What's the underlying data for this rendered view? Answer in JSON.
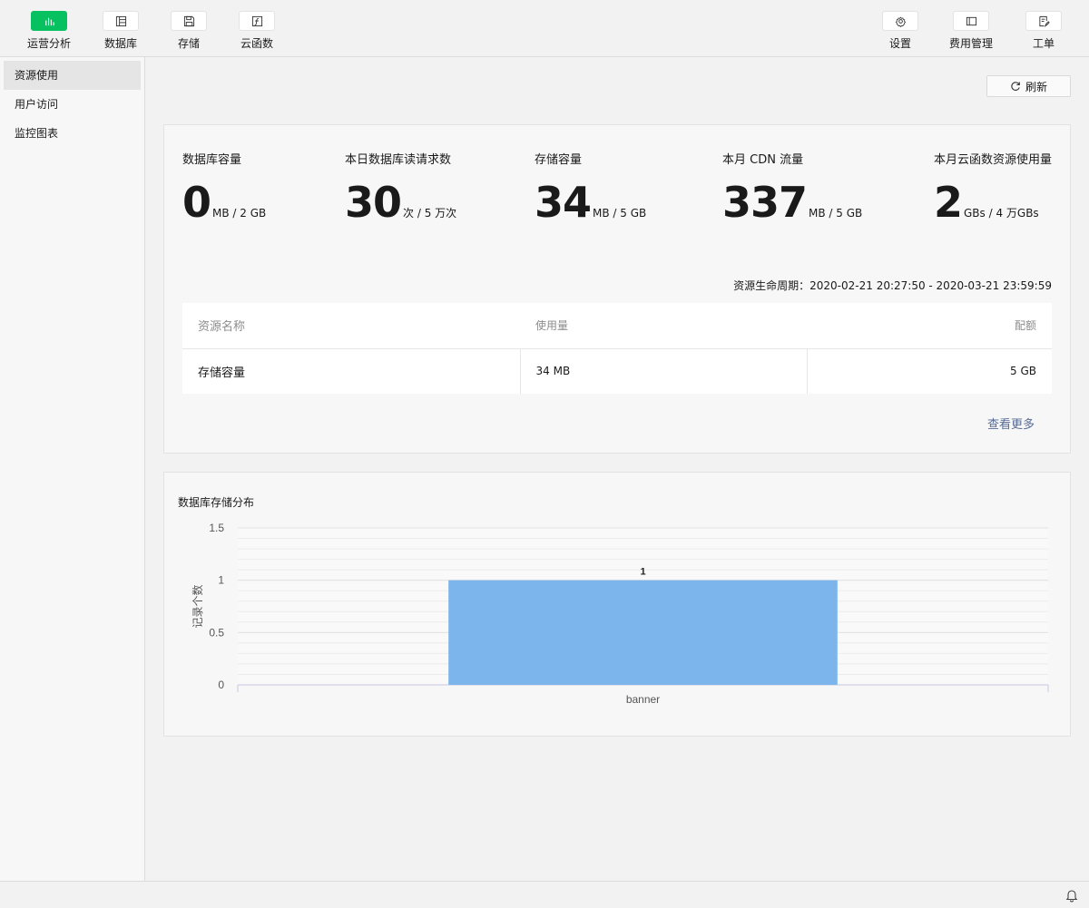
{
  "nav": {
    "left": [
      {
        "label": "运营分析",
        "icon": "bar-chart-icon"
      },
      {
        "label": "数据库",
        "icon": "database-icon"
      },
      {
        "label": "存储",
        "icon": "save-icon"
      },
      {
        "label": "云函数",
        "icon": "function-icon"
      }
    ],
    "right": [
      {
        "label": "设置",
        "icon": "gear-icon"
      },
      {
        "label": "费用管理",
        "icon": "billing-icon"
      },
      {
        "label": "工单",
        "icon": "ticket-icon"
      }
    ]
  },
  "sidebar": {
    "items": [
      {
        "label": "资源使用"
      },
      {
        "label": "用户访问"
      },
      {
        "label": "监控图表"
      }
    ]
  },
  "toolbar": {
    "refresh_label": "刷新"
  },
  "stats": [
    {
      "label": "数据库容量",
      "value": "0",
      "unit": "MB / 2 GB"
    },
    {
      "label": "本日数据库读请求数",
      "value": "30",
      "unit": "次 / 5 万次"
    },
    {
      "label": "存储容量",
      "value": "34",
      "unit": "MB / 5 GB"
    },
    {
      "label": "本月 CDN 流量",
      "value": "337",
      "unit": "MB / 5 GB"
    },
    {
      "label": "本月云函数资源使用量",
      "value": "2",
      "unit": "GBs / 4 万GBs"
    }
  ],
  "lifecycle": "资源生命周期：2020-02-21 20:27:50 - 2020-03-21 23:59:59",
  "resource_table": {
    "headers": {
      "name": "资源名称",
      "usage": "使用量",
      "quota": "配额"
    },
    "rows": [
      {
        "name": "存储容量",
        "usage": "34 MB",
        "quota": "5 GB"
      }
    ]
  },
  "more_link": "查看更多",
  "chart_title": "数据库存储分布",
  "chart_data": {
    "type": "bar",
    "categories": [
      "banner"
    ],
    "values": [
      1
    ],
    "title": "数据库存储分布",
    "xlabel": "",
    "ylabel": "记录个数",
    "ylim": [
      0,
      1.5
    ],
    "yticks": [
      "0",
      "0.5",
      "1",
      "1.5"
    ],
    "data_labels": [
      "1"
    ],
    "bar_color": "#7cb5ec",
    "grid": true
  },
  "colors": {
    "accent": "#07c160",
    "link": "#576b95"
  }
}
